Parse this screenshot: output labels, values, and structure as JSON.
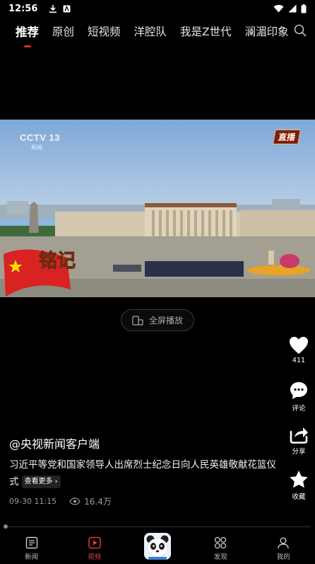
{
  "status_bar": {
    "time": "12:56"
  },
  "top_tabs": [
    {
      "label": "推荐",
      "active": true
    },
    {
      "label": "原创"
    },
    {
      "label": "短视频"
    },
    {
      "label": "洋腔队"
    },
    {
      "label": "我是Z世代"
    },
    {
      "label": "澜湄印象"
    }
  ],
  "video": {
    "channel_logo": "CCTV 13",
    "channel_sub": "新闻",
    "live_badge": "直播",
    "overlay_text": "铭记"
  },
  "fullscreen_button": {
    "label": "全屏播放",
    "icon": "fullscreen-phone-icon"
  },
  "actions": {
    "like": {
      "count": "411",
      "icon": "heart-icon"
    },
    "comment": {
      "label": "评论",
      "icon": "comment-icon"
    },
    "share": {
      "label": "分享",
      "icon": "share-icon"
    },
    "favorite": {
      "label": "收藏",
      "icon": "star-icon"
    }
  },
  "post": {
    "author": "@央视新闻客户端",
    "caption": "习近平等党和国家领导人出席烈士纪念日向人民英雄敬献花篮仪式",
    "more_label": "查看更多",
    "timestamp": "09-30 11:15",
    "views": "16.4万"
  },
  "bottom_nav": [
    {
      "label": "新闻",
      "icon": "news-icon"
    },
    {
      "label": "视频",
      "icon": "video-play-icon",
      "active": true
    },
    {
      "label": "",
      "icon": "panda-icon"
    },
    {
      "label": "发现",
      "icon": "discover-icon"
    },
    {
      "label": "我的",
      "icon": "profile-icon"
    }
  ],
  "colors": {
    "accent": "#e52b2b",
    "background": "#000000"
  }
}
